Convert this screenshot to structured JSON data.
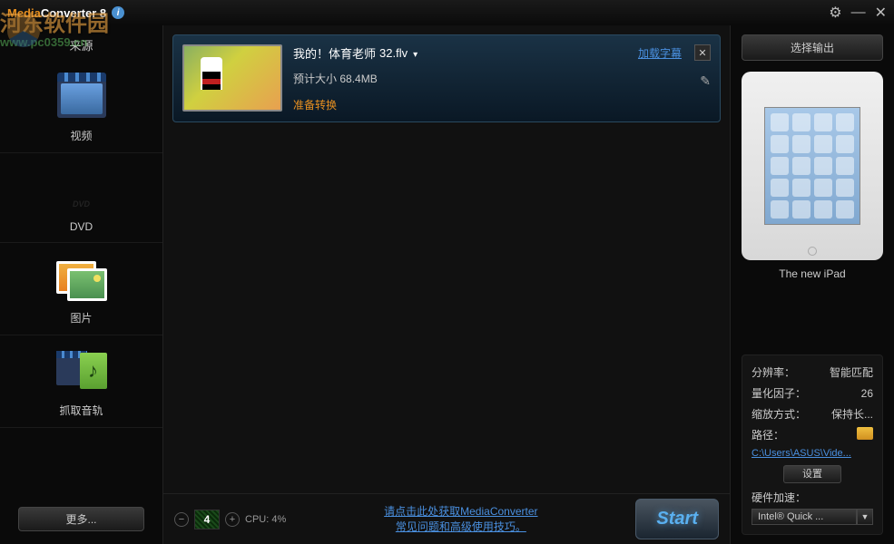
{
  "app": {
    "title_a": "Media",
    "title_b": "Converter",
    "version": "8"
  },
  "watermark": {
    "text": "河东软件园",
    "url": "www.pc0359.cn"
  },
  "sidebar": {
    "header": "来源",
    "items": [
      {
        "label": "视频"
      },
      {
        "label": "DVD",
        "dvd_text": "DVD"
      },
      {
        "label": "图片"
      },
      {
        "label": "抓取音轨"
      }
    ],
    "more": "更多..."
  },
  "file": {
    "name_prefix": "我的！体育老师",
    "name_suffix": "32.flv",
    "size_label": "预计大小",
    "size_value": "68.4MB",
    "status": "准备转换",
    "subtitle_link": "加载字幕"
  },
  "bottom": {
    "cpu_count": "4",
    "cpu_label": "CPU: 4%",
    "link_line1": "请点击此处获取MediaConverter",
    "link_line2": "常见问题和高级使用技巧。",
    "start": "Start"
  },
  "output": {
    "select_btn": "选择输出",
    "device": "The new iPad",
    "resolution_k": "分辨率：",
    "resolution_v": "智能匹配",
    "quant_k": "量化因子：",
    "quant_v": "26",
    "scale_k": "缩放方式：",
    "scale_v": "保持长...",
    "path_k": "路径：",
    "path_link": "C:\\Users\\ASUS\\Vide...",
    "settings_btn": "设置",
    "hw_label": "硬件加速：",
    "hw_value": "Intel® Quick ..."
  }
}
